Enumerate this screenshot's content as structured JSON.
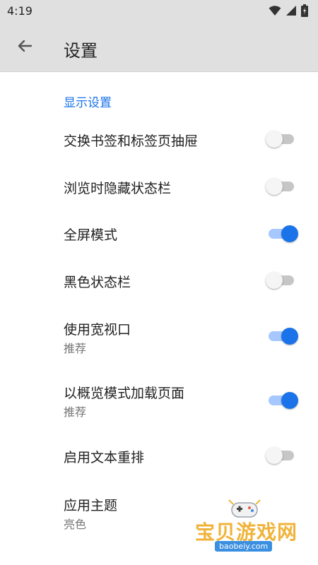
{
  "status_bar": {
    "time": "4:19"
  },
  "app_bar": {
    "title": "设置"
  },
  "section": {
    "display_settings": "显示设置"
  },
  "settings": [
    {
      "label": "交换书签和标签页抽屉",
      "sublabel": "",
      "enabled": false
    },
    {
      "label": "浏览时隐藏状态栏",
      "sublabel": "",
      "enabled": false
    },
    {
      "label": "全屏模式",
      "sublabel": "",
      "enabled": true
    },
    {
      "label": "黑色状态栏",
      "sublabel": "",
      "enabled": false
    },
    {
      "label": "使用宽视口",
      "sublabel": "推荐",
      "enabled": true
    },
    {
      "label": "以概览模式加载页面",
      "sublabel": "推荐",
      "enabled": true
    },
    {
      "label": "启用文本重排",
      "sublabel": "",
      "enabled": false
    },
    {
      "label": "应用主题",
      "sublabel": "亮色"
    }
  ],
  "watermark": {
    "text": "宝贝游戏网",
    "url": "baobeiy.com"
  },
  "colors": {
    "accent": "#1a73e8",
    "track_on": "#a6c8ff",
    "track_off": "#c6c6c6",
    "bar": "#e0e0e0"
  }
}
